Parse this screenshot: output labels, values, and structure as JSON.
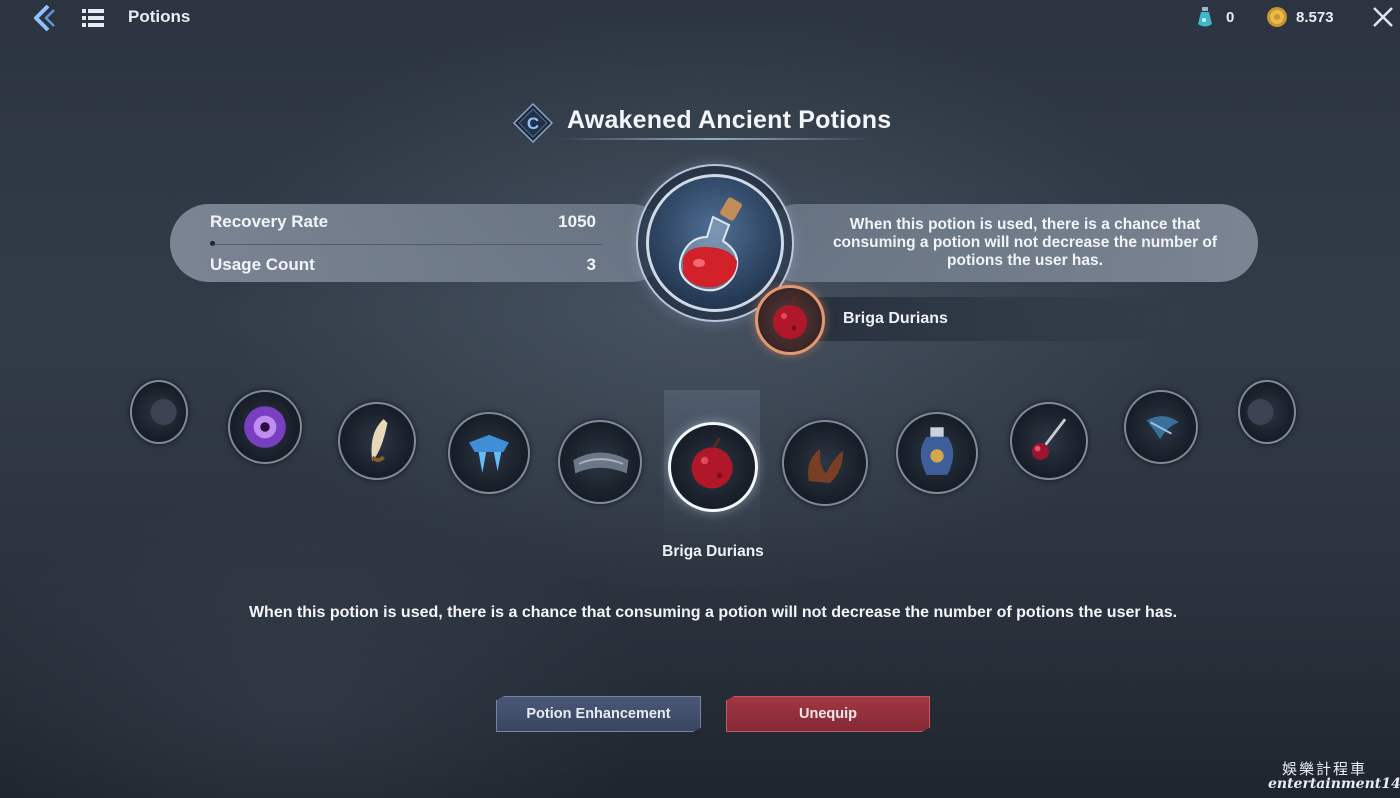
{
  "topbar": {
    "title": "Potions",
    "resources": [
      {
        "icon": "crystal-vial-icon",
        "value": "0"
      },
      {
        "icon": "gold-coin-icon",
        "value": "8.573"
      }
    ]
  },
  "potion": {
    "grade": "C",
    "name": "Awakened Ancient Potions",
    "stats": [
      {
        "label": "Recovery Rate",
        "value": "1050"
      },
      {
        "label": "Usage Count",
        "value": "3"
      }
    ],
    "effect_description": "When this potion is used, there is a chance that consuming a potion will not decrease the number of potions the user has.",
    "ingredient": "Briga Durians",
    "icon": "red-potion-flask-icon"
  },
  "carousel": {
    "items": [
      {
        "icon": "partial-item-icon"
      },
      {
        "icon": "purple-orb-icon"
      },
      {
        "icon": "fang-icon"
      },
      {
        "icon": "ice-crystal-icon"
      },
      {
        "icon": "ore-slab-icon"
      },
      {
        "icon": "briga-durian-icon",
        "selected": true
      },
      {
        "icon": "horn-icon"
      },
      {
        "icon": "blue-vase-icon"
      },
      {
        "icon": "crimson-wand-icon"
      },
      {
        "icon": "blue-feather-icon"
      },
      {
        "icon": "partial-item-icon"
      }
    ],
    "selected_label": "Briga Durians"
  },
  "description": "When this potion is used, there is a chance that consuming a potion will not decrease the number of potions the user has.",
  "buttons": {
    "enhance": "Potion Enhancement",
    "unequip": "Unequip"
  },
  "watermark": {
    "chinese": "娛樂計程車",
    "english": "entertainment14"
  },
  "colors": {
    "background": "#2b3440",
    "enhance_button": "#3f4c68",
    "unequip_button": "#952f3c",
    "ingredient_ring": "#e39870"
  }
}
